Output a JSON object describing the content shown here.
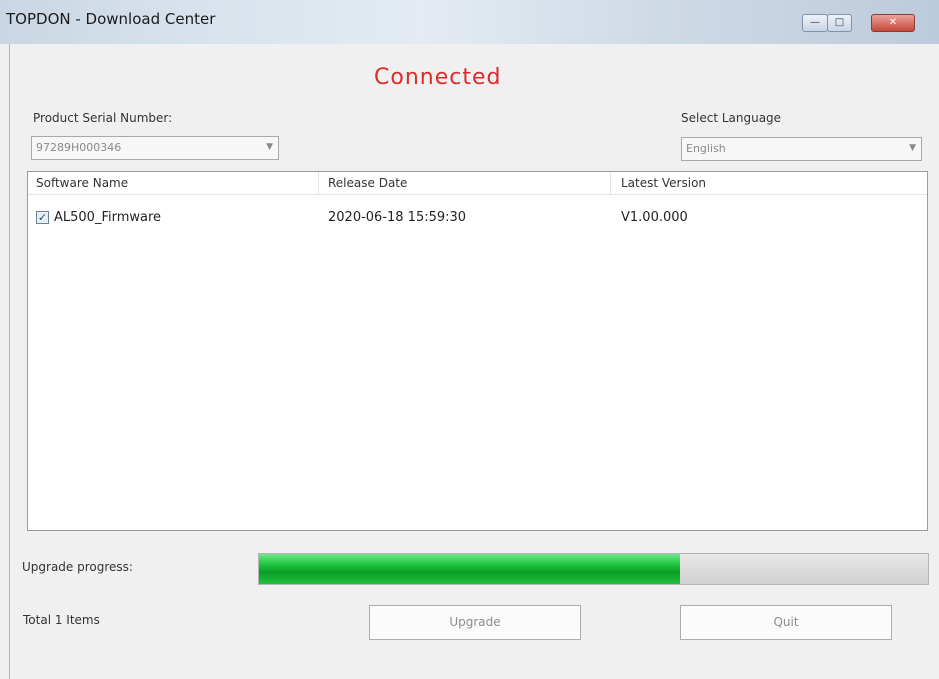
{
  "window": {
    "title": "TOPDON - Download Center"
  },
  "status": {
    "text": "Connected",
    "color": "#dd2b2b"
  },
  "serial": {
    "label": "Product Serial Number:",
    "value": "97289H000346"
  },
  "language": {
    "label": "Select Language",
    "value": "English"
  },
  "table": {
    "columns": [
      "Software Name",
      "Release Date",
      "Latest Version"
    ],
    "rows": [
      {
        "checked": true,
        "name": "AL500_Firmware",
        "date": "2020-06-18 15:59:30",
        "version": "V1.00.000"
      }
    ]
  },
  "progress": {
    "label": "Upgrade progress:",
    "value": 0.63
  },
  "footer": {
    "total": "Total 1 Items",
    "upgrade_label": "Upgrade",
    "quit_label": "Quit"
  }
}
